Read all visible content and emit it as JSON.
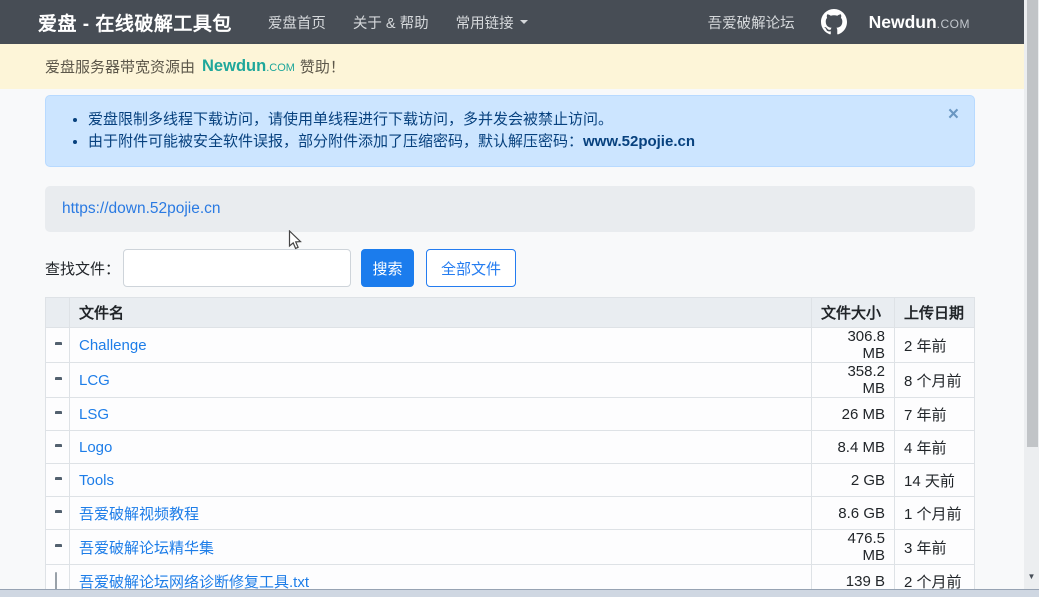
{
  "navbar": {
    "brand": "爱盘 - 在线破解工具包",
    "links": [
      {
        "label": "爱盘首页"
      },
      {
        "label": "关于 & 帮助"
      },
      {
        "label": "常用链接"
      }
    ],
    "forum_link": "吾爱破解论坛",
    "logo_main": "Newdun",
    "logo_suffix": ".COM"
  },
  "sponsor": {
    "prefix": "爱盘服务器带宽资源由",
    "brand_main": "Newdun",
    "brand_suffix": ".COM",
    "suffix": "赞助！"
  },
  "alert": {
    "line1": "爱盘限制多线程下载访问，请使用单线程进行下载访问，多并发会被禁止访问。",
    "line2": "由于附件可能被安全软件误报，部分附件添加了压缩密码，默认解压密码：",
    "line2_bold": "www.52pojie.cn",
    "close_label": "×"
  },
  "breadcrumb": {
    "url": "https://down.52pojie.cn"
  },
  "search": {
    "label": "查找文件：",
    "input_value": "",
    "search_button": "搜索",
    "all_files_button": "全部文件"
  },
  "table": {
    "columns": [
      "文件名",
      "文件大小",
      "上传日期"
    ],
    "rows": [
      {
        "icon": "folder",
        "name": "Challenge",
        "size": "306.8 MB",
        "date": "2 年前"
      },
      {
        "icon": "folder",
        "name": "LCG",
        "size": "358.2 MB",
        "date": "8 个月前"
      },
      {
        "icon": "folder",
        "name": "LSG",
        "size": "26 MB",
        "date": "7 年前"
      },
      {
        "icon": "folder",
        "name": "Logo",
        "size": "8.4 MB",
        "date": "4 年前"
      },
      {
        "icon": "folder",
        "name": "Tools",
        "size": "2 GB",
        "date": "14 天前"
      },
      {
        "icon": "folder",
        "name": "吾爱破解视频教程",
        "size": "8.6 GB",
        "date": "1 个月前"
      },
      {
        "icon": "folder",
        "name": "吾爱破解论坛精华集",
        "size": "476.5 MB",
        "date": "3 年前"
      },
      {
        "icon": "file",
        "name": "吾爱破解论坛网络诊断修复工具.txt",
        "size": "139 B",
        "date": "2 个月前"
      }
    ]
  },
  "colors": {
    "accent": "#1b7ced",
    "navbar_bg": "#474d55",
    "sponsor_bg": "#fdf5d8",
    "sponsor_brand": "#1fa79b",
    "alert_bg": "#cce5ff",
    "alert_text": "#07417e",
    "breadcrumb_bg": "#e9ecef",
    "link_blue": "#1d7de8"
  }
}
